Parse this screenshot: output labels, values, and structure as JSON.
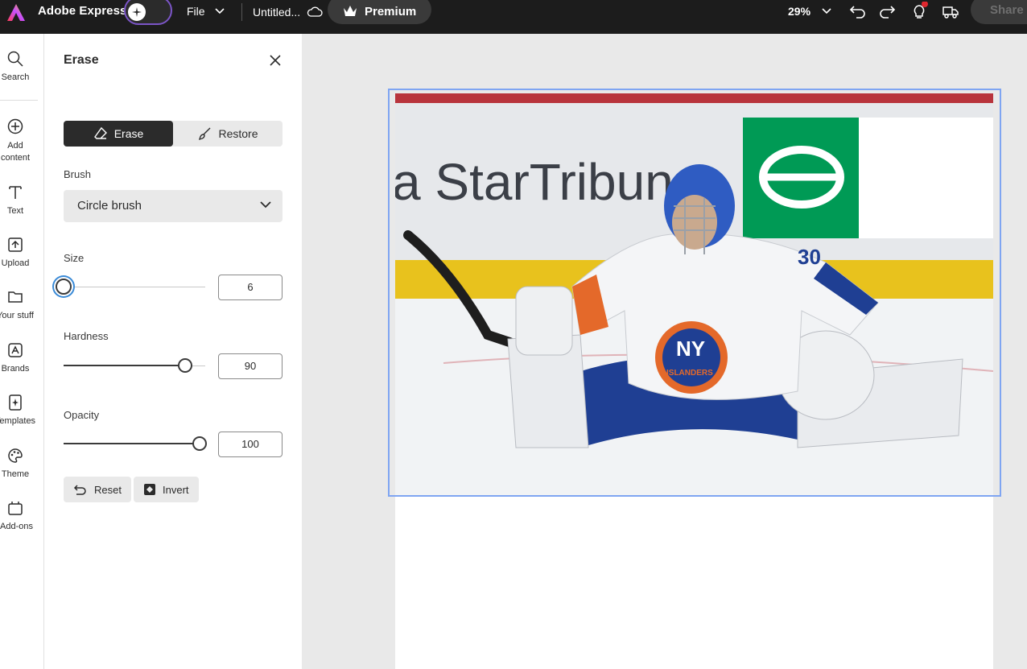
{
  "topbar": {
    "app_title": "Adobe Express",
    "file_label": "File",
    "doc_title": "Untitled...",
    "premium_label": "Premium",
    "zoom_label": "29%",
    "share_label": "Share"
  },
  "rail": {
    "items": [
      {
        "label": "Search",
        "icon": "search-icon"
      },
      {
        "label": "Add content",
        "icon": "plus-circle-icon"
      },
      {
        "label": "Text",
        "icon": "text-icon"
      },
      {
        "label": "Upload",
        "icon": "upload-icon"
      },
      {
        "label": "Your stuff",
        "icon": "folder-icon"
      },
      {
        "label": "Brands",
        "icon": "brand-icon"
      },
      {
        "label": "Templates",
        "icon": "templates-icon"
      },
      {
        "label": "Theme",
        "icon": "palette-icon"
      },
      {
        "label": "Add-ons",
        "icon": "addons-icon"
      }
    ]
  },
  "panel": {
    "title": "Erase",
    "tabs": {
      "erase": "Erase",
      "restore": "Restore"
    },
    "brush_label": "Brush",
    "brush_value": "Circle brush",
    "size": {
      "label": "Size",
      "value": "6",
      "level": 0.0
    },
    "hardness": {
      "label": "Hardness",
      "value": "90",
      "level": 0.86
    },
    "opacity": {
      "label": "Opacity",
      "value": "100",
      "level": 0.96
    },
    "reset_label": "Reset",
    "invert_label": "Invert"
  },
  "photo": {
    "sign_text": "a StarTribune",
    "jersey_number": "30",
    "crest_text": "NY",
    "crest_sub": "ISLANDERS",
    "colors": {
      "jersey_blue": "#1f3f93",
      "jersey_orange": "#e4692a",
      "brand_green": "#009a55",
      "rink_yellow": "#e8c21d"
    }
  }
}
